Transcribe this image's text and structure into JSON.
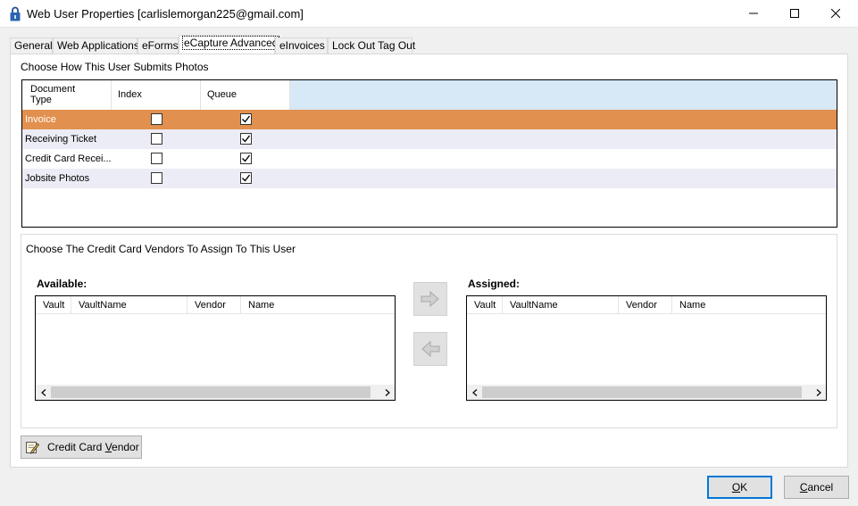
{
  "window": {
    "title": "Web User Properties [carlislemorgan225@gmail.com]",
    "icons": {
      "app": "lock-icon",
      "minimize": "minimize-icon",
      "maximize": "maximize-icon",
      "close": "close-icon"
    }
  },
  "tabs": [
    {
      "label": "General",
      "active": false
    },
    {
      "label": "Web Applications",
      "active": false
    },
    {
      "label": "eForms",
      "active": false
    },
    {
      "label": "eCapture Advanced",
      "active": true
    },
    {
      "label": "eInvoices",
      "active": false
    },
    {
      "label": "Lock Out Tag Out",
      "active": false
    }
  ],
  "photos": {
    "section_label": "Choose How This User Submits Photos",
    "columns": {
      "doc_type_line1": "Document",
      "doc_type_line2": "Type",
      "index": "Index",
      "queue": "Queue"
    },
    "rows": [
      {
        "document_type": "Invoice",
        "index": false,
        "queue": true,
        "selected": true
      },
      {
        "document_type": "Receiving Ticket",
        "index": false,
        "queue": true,
        "selected": false
      },
      {
        "document_type": "Credit Card Recei...",
        "index": false,
        "queue": true,
        "selected": false
      },
      {
        "document_type": "Jobsite Photos",
        "index": false,
        "queue": true,
        "selected": false
      }
    ]
  },
  "vendors": {
    "section_label": "Choose The Credit Card Vendors To Assign To This User",
    "available": {
      "title": "Available:",
      "columns": [
        "Vault",
        "VaultName",
        "Vendor",
        "Name"
      ],
      "rows": []
    },
    "assigned": {
      "title": "Assigned:",
      "columns": [
        "Vault",
        "VaultName",
        "Vendor",
        "Name"
      ],
      "rows": []
    },
    "assign_button_icon": "arrow-right-icon",
    "unassign_button_icon": "arrow-left-icon"
  },
  "buttons": {
    "credit_card_vendor": {
      "pre": "Credit Card ",
      "accel": "V",
      "post": "endor",
      "icon": "pencil-paper-icon"
    },
    "ok": {
      "accel": "O",
      "post": "K"
    },
    "cancel": {
      "accel": "C",
      "post": "ancel"
    }
  },
  "colors": {
    "selected_row": "#e2904f",
    "alt_row": "#ececf6",
    "grid_header_bg": "#d7e8f6",
    "default_button_border": "#0078d7"
  }
}
